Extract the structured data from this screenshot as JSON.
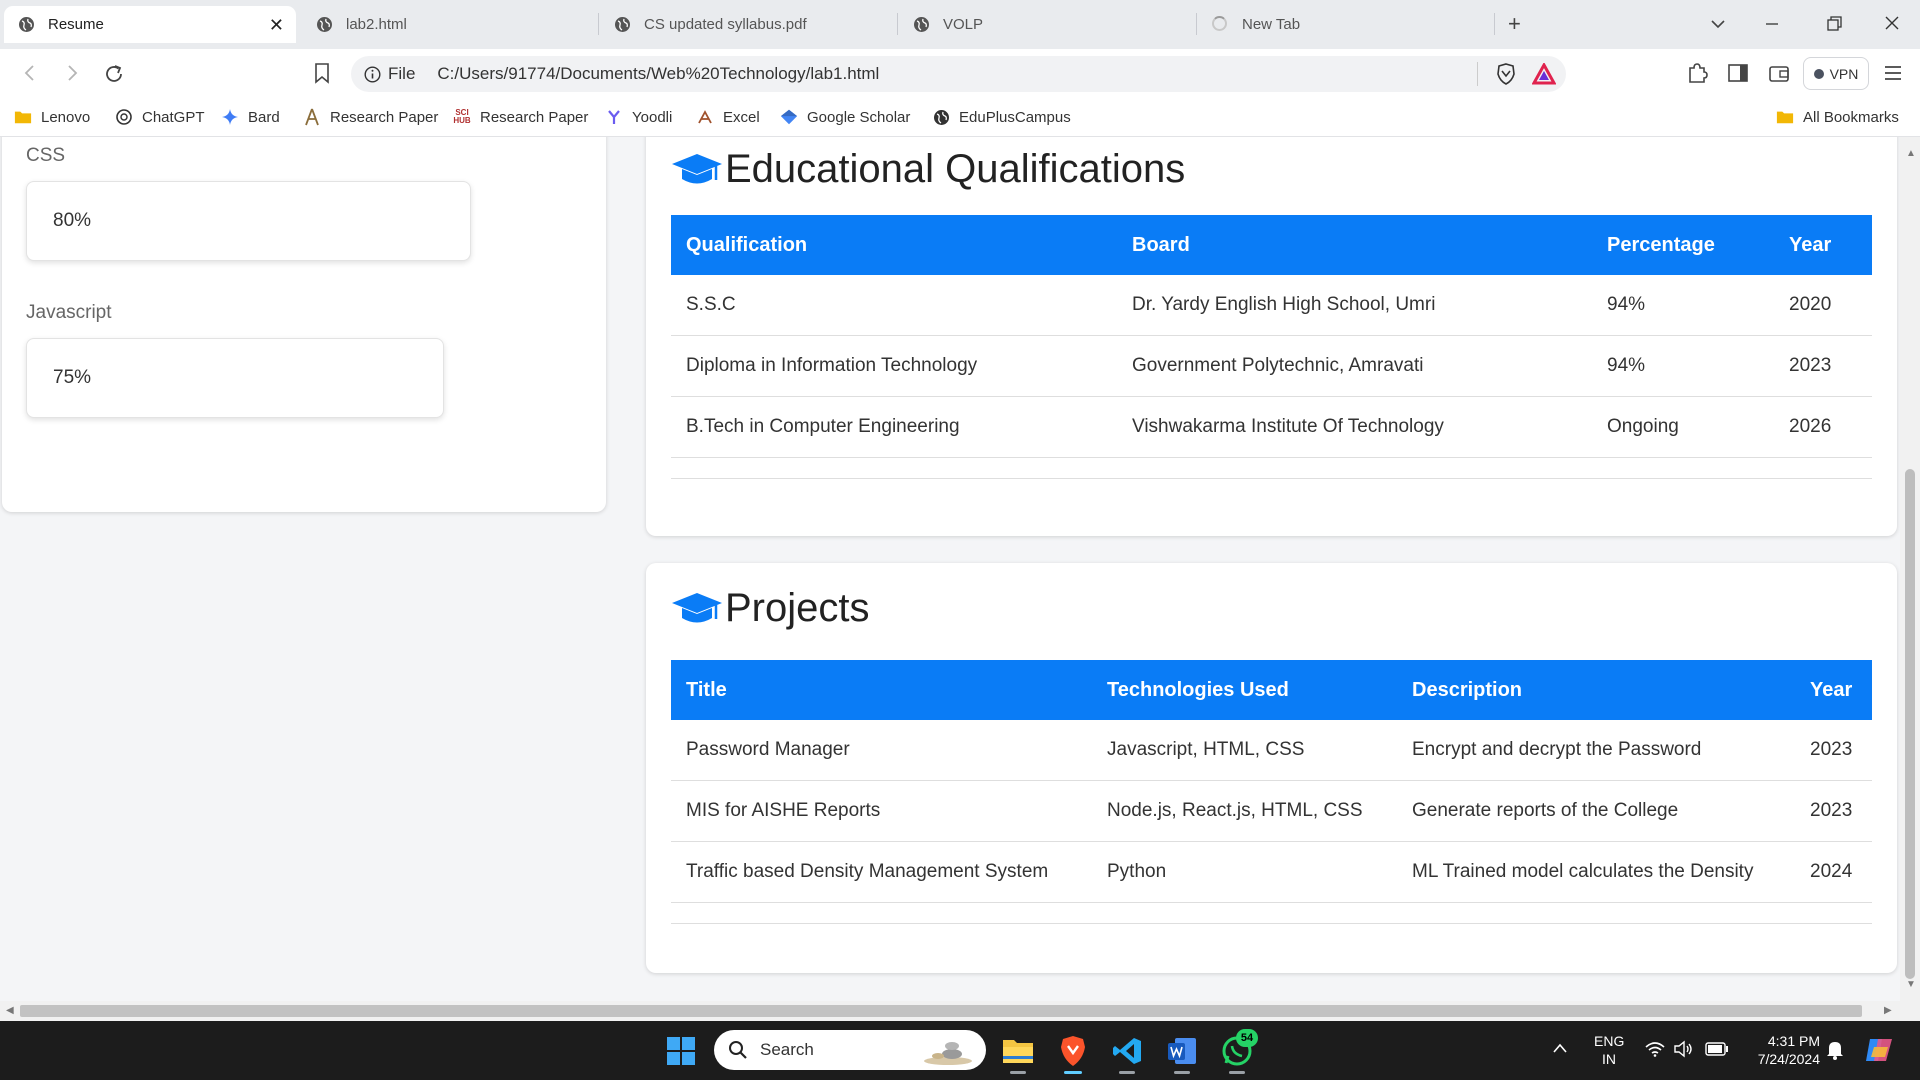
{
  "browser": {
    "tabs": [
      {
        "title": "Resume",
        "active": true,
        "icon": "globe-icon"
      },
      {
        "title": "lab2.html",
        "active": false,
        "icon": "globe-icon"
      },
      {
        "title": "CS updated syllabus.pdf",
        "active": false,
        "icon": "globe-icon"
      },
      {
        "title": "VOLP",
        "active": false,
        "icon": "globe-icon"
      },
      {
        "title": "New Tab",
        "active": false,
        "icon": "loading-spinner-icon"
      }
    ],
    "address": {
      "scheme_label": "File",
      "url": "C:/Users/91774/Documents/Web%20Technology/lab1.html"
    },
    "vpn_label": "VPN",
    "bookmarks": [
      {
        "label": "Lenovo",
        "icon": "folder-icon"
      },
      {
        "label": "ChatGPT",
        "icon": "chatgpt-icon"
      },
      {
        "label": "Bard",
        "icon": "sparkle-icon"
      },
      {
        "label": "Research Paper",
        "icon": "research-icon"
      },
      {
        "label": "Research Paper",
        "icon": "scihub-icon",
        "icon_text": "SCI HUB"
      },
      {
        "label": "Yoodli",
        "icon": "yoodli-icon"
      },
      {
        "label": "Excel",
        "icon": "excel-icon"
      },
      {
        "label": "Google Scholar",
        "icon": "scholar-icon"
      },
      {
        "label": "EduPlusCampus",
        "icon": "globe-icon"
      }
    ],
    "all_bookmarks_label": "All Bookmarks"
  },
  "skills": [
    {
      "name": "CSS",
      "value": "80%"
    },
    {
      "name": "Javascript",
      "value": "75%"
    }
  ],
  "education": {
    "title": "Educational Qualifications",
    "headers": [
      "Qualification",
      "Board",
      "Percentage",
      "Year"
    ],
    "rows": [
      [
        "S.S.C",
        "Dr. Yardy English High School, Umri",
        "94%",
        "2020"
      ],
      [
        "Diploma in Information Technology",
        "Government Polytechnic, Amravati",
        "94%",
        "2023"
      ],
      [
        "B.Tech in Computer Engineering",
        "Vishwakarma Institute Of Technology",
        "Ongoing",
        "2026"
      ]
    ]
  },
  "projects": {
    "title": "Projects",
    "headers": [
      "Title",
      "Technologies Used",
      "Description",
      "Year"
    ],
    "rows": [
      [
        "Password Manager",
        "Javascript, HTML, CSS",
        "Encrypt and decrypt the Password",
        "2023"
      ],
      [
        "MIS for AISHE Reports",
        "Node.js, React.js, HTML, CSS",
        "Generate reports of the College",
        "2023"
      ],
      [
        "Traffic based Density Management System",
        "Python",
        "ML Trained model calculates the Density",
        "2024"
      ]
    ]
  },
  "taskbar": {
    "search_placeholder": "Search",
    "whatsapp_badge": "54",
    "language": "ENG",
    "region": "IN",
    "time": "4:31 PM",
    "date": "7/24/2024"
  },
  "colors": {
    "table_header": "#0a7cf6",
    "graduation_cap": "#0a7cf6"
  }
}
